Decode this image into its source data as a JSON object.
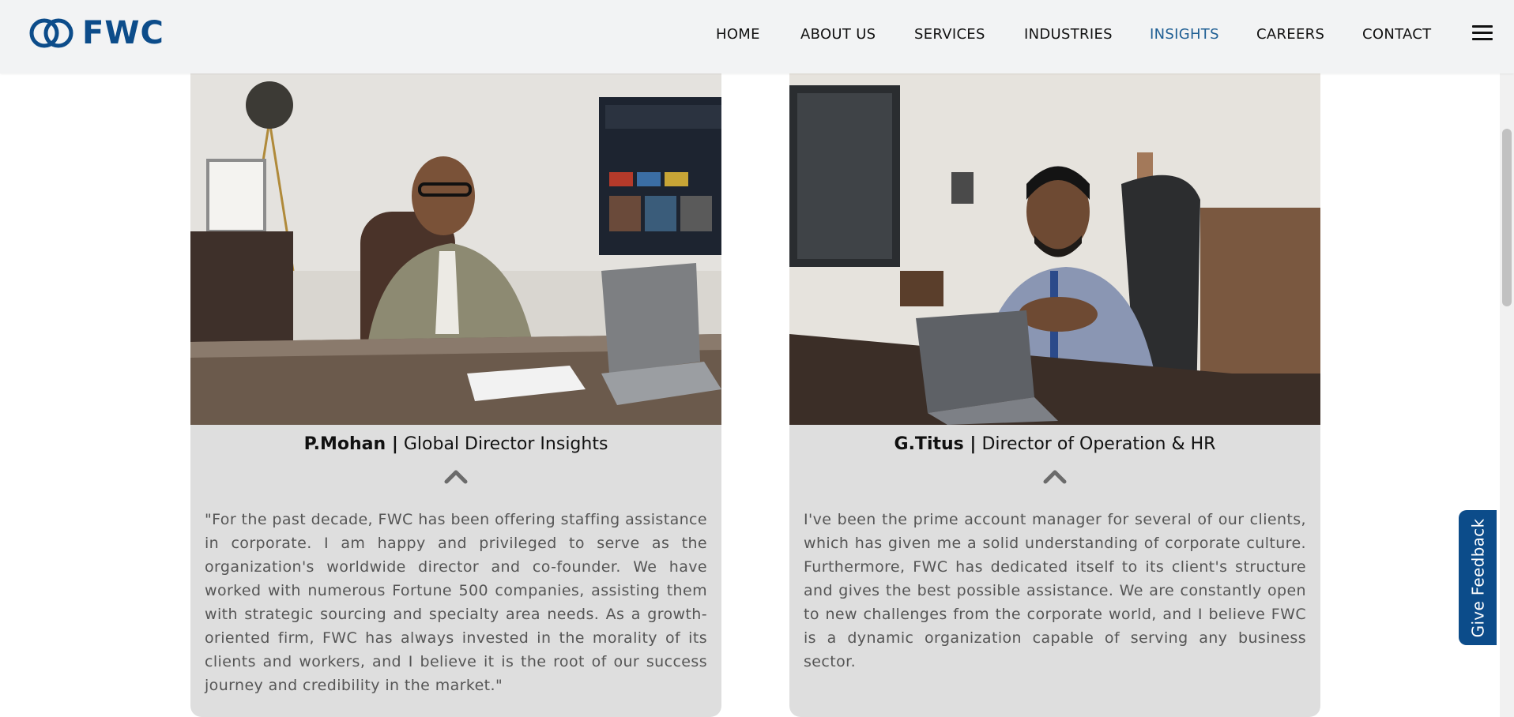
{
  "brand": {
    "name": "FWC",
    "color": "#0c4c8a"
  },
  "nav": {
    "items": [
      {
        "label": "HOME"
      },
      {
        "label": "ABOUT US"
      },
      {
        "label": "SERVICES"
      },
      {
        "label": "INDUSTRIES"
      },
      {
        "label": "INSIGHTS",
        "active": true
      },
      {
        "label": "CAREERS"
      },
      {
        "label": "CONTACT"
      }
    ],
    "menu_icon": "hamburger-icon"
  },
  "people": [
    {
      "name": "P.Mohan |",
      "role": " Global Director Insights",
      "toggle_icon": "chevron-up-icon",
      "quote": "\"For the past decade, FWC has been offering staffing assistance in corporate. I am happy and privileged to serve as the organization's worldwide director and co-founder. We have worked with numerous Fortune 500 companies, assisting them with strategic sourcing and specialty area needs. As a growth-oriented firm, FWC has always invested in the morality of its clients and workers, and I believe it is the root of our success journey and credibility in the market.\""
    },
    {
      "name": "G.Titus |",
      "role": " Director of Operation & HR",
      "toggle_icon": "chevron-up-icon",
      "quote": "I've been the prime account manager for several of our clients, which has given me a solid understanding of corporate culture. Furthermore, FWC has dedicated itself to its client's structure and gives the best possible assistance. We are constantly open to new challenges from the corporate world, and I believe FWC is a dynamic organization capable of serving any business sector."
    }
  ],
  "feedback": {
    "label": "Give Feedback",
    "color": "#0c4c8a"
  }
}
